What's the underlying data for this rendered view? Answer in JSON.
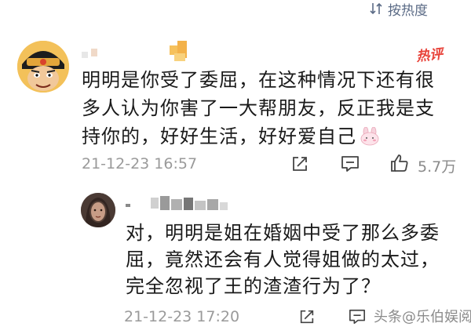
{
  "header": {
    "sort_label": "按热度",
    "sort_icon": "sort-icon"
  },
  "comment1": {
    "badge": "热评",
    "lines": [
      "明明是你受了委屈，在这种情况下还有很",
      "多人认为你害了一大帮朋友，反正我是支",
      "持你的，好好生活，好好爱自己"
    ],
    "emoji": "rabbit-emoji-icon",
    "timestamp": "21-12-23 16:57",
    "like_count": "5.7万"
  },
  "reply1": {
    "lines": [
      "对，明明是姐在婚姻中受了那么多委",
      "屈，竟然还会有人觉得姐做的太过，",
      "完全忽视了王的渣渣行为了？"
    ],
    "timestamp": "21-12-23 17:20"
  },
  "watermark": "头条@乐伯娱阅",
  "colors": {
    "hot_red": "#e8433a",
    "icon_gray": "#5b6b86",
    "time_gray": "#9a9a9a"
  }
}
